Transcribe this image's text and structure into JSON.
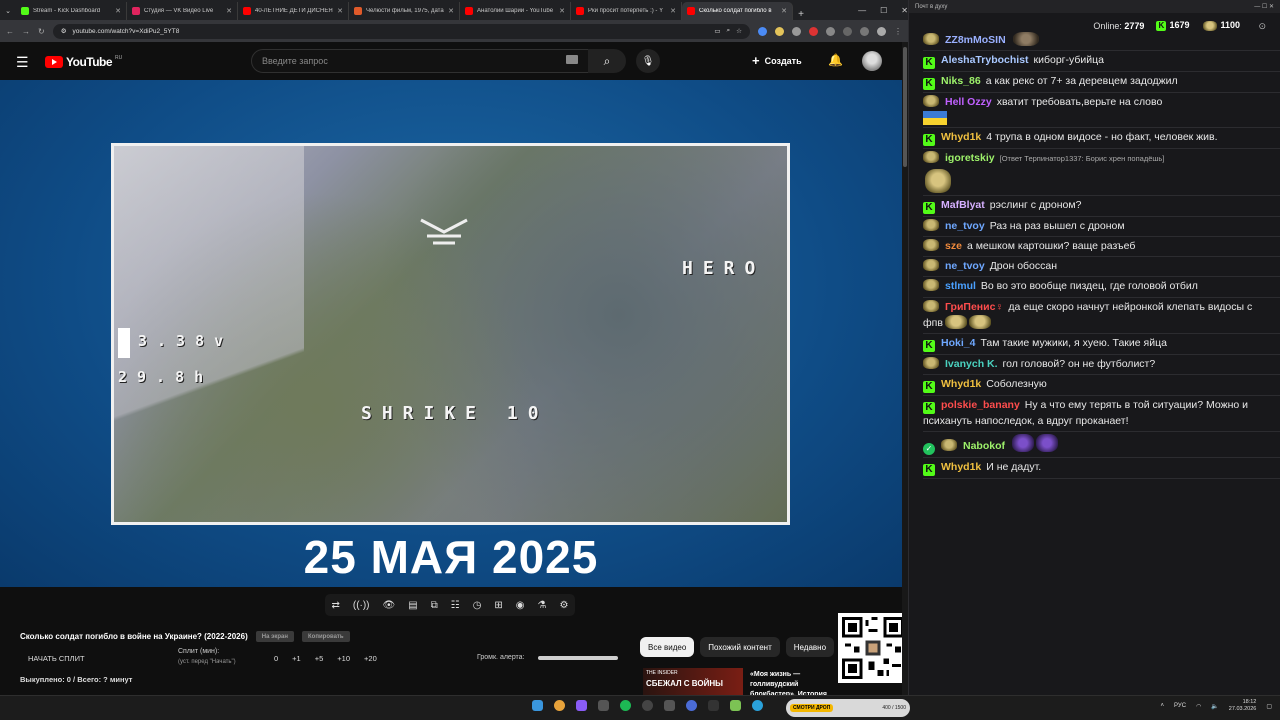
{
  "browser": {
    "tabs": [
      {
        "label": "Stream - Kick Dashboard",
        "color": "#53fc18",
        "active": false
      },
      {
        "label": "Студия — VK Видео Live",
        "color": "#e0245e",
        "active": false
      },
      {
        "label": "40-ЛЕТНИЕ ДЕТИ ДИСНЕЯ",
        "color": "#ff0000",
        "active": false
      },
      {
        "label": "Челюсти фильм, 1975, дата",
        "color": "#e05a2a",
        "active": false
      },
      {
        "label": "Анатолий Шарий - YouTube",
        "color": "#ff0000",
        "active": false
      },
      {
        "label": "Рки просит потерпеть :) - Y",
        "color": "#ff0000",
        "active": false
      },
      {
        "label": "Сколько солдат погибло в",
        "color": "#ff0000",
        "active": true
      }
    ],
    "new_tab": "+",
    "url": "youtube.com/watch?v=XdiPu2_5YT8"
  },
  "youtube": {
    "logo_text": "YouTube",
    "region": "RU",
    "search_placeholder": "Введите запрос",
    "create_label": "Создать"
  },
  "video": {
    "osd_hero": "HERO",
    "osd_volt": "3.38v",
    "osd_mah": "29.8h",
    "osd_strike": "SHRIKE 10",
    "caption": "25 МАЯ 2025"
  },
  "player_tools": [
    "⇄",
    "((·))",
    "👁",
    "▤",
    "⧉",
    "☷",
    "◷",
    "⊞",
    "◉",
    "⚗",
    "⚙"
  ],
  "below": {
    "title": "Сколько солдат погибло в войне на Украине? (2022-2026)",
    "chip_a": "На экран",
    "chip_b": "Копировать",
    "split_start": "НАЧАТЬ СПЛИТ",
    "split_label": "Сплит (мин):",
    "split_sub": "(уст. перед \"Начать\")",
    "split_nums": [
      "0",
      "+1",
      "+5",
      "+10",
      "+20"
    ],
    "alert_label": "Громк. алерта:",
    "bought": "Выкуплено: 0 / Всего: ? минут",
    "chips": [
      "Все видео",
      "Похожий контент",
      "Недавно"
    ],
    "rec_thumb_top": "THE INSIDER",
    "rec_thumb_big": "СБЕЖАЛ С ВОЙНЫ",
    "rec_title": "«Моя жизнь — голливудский блокбастер». История казак..."
  },
  "chat": {
    "window_title": "Почт в духу",
    "online_label": "Online:",
    "online_value": "2779",
    "kick_count": "1679",
    "emote_count": "1100",
    "messages": [
      {
        "badge": "e",
        "nick": "ZZ8mMoSIN",
        "color": "#9ab0ff",
        "text": "",
        "emote": "face"
      },
      {
        "badge": "k",
        "nick": "AleshaTrybochist",
        "color": "#a9c8ff",
        "text": "киборг-убийца"
      },
      {
        "badge": "k",
        "nick": "Niks_86",
        "color": "#9ef26b",
        "text": "а как рекс от 7+ за деревцем задоджил"
      },
      {
        "badge": "e",
        "nick": "Hell Ozzy",
        "color": "#c060ff",
        "text": "хватит требовать,верьте на слово",
        "flag": true
      },
      {
        "badge": "k",
        "nick": "Whyd1k",
        "color": "#f0c040",
        "text": "4 трупа в одном видосе - но факт, человек жив."
      },
      {
        "badge": "e",
        "nick": "igoretskiy",
        "color": "#9ef26b",
        "reply": "[Ответ Терпинатор1337: Борис хрен попадёшь]",
        "text": "",
        "emote": "big"
      },
      {
        "badge": "k",
        "nick": "MafBlyat",
        "color": "#d6b0ff",
        "text": "рэслинг с дроном?"
      },
      {
        "badge": "e",
        "nick": "ne_tvoy",
        "color": "#6fa8ff",
        "text": "Раз на раз вышел с дроном"
      },
      {
        "badge": "e",
        "nick": "sze",
        "color": "#f08a3c",
        "text": "а мешком картошки? ваще разъеб"
      },
      {
        "badge": "e",
        "nick": "ne_tvoy",
        "color": "#6fa8ff",
        "text": "Дрон обоссан"
      },
      {
        "badge": "e",
        "nick": "stlmul",
        "color": "#4aa0ff",
        "text": "Во во это вообще пиздец, где головой отбил"
      },
      {
        "badge": "e",
        "nick": "ГриПенис♀",
        "color": "#ff4d4d",
        "text": "да еще скоро начнут нейронкой клепать видосы с фпв",
        "emote": "two"
      },
      {
        "badge": "k",
        "nick": "Hoki_4",
        "color": "#6fa8ff",
        "text": "Там такие мужики, я хуею. Такие яйца"
      },
      {
        "badge": "e",
        "nick": "Ivanych K.",
        "color": "#4ad2c0",
        "text": "гол головой? он не футболист?"
      },
      {
        "badge": "k",
        "nick": "Whyd1k",
        "color": "#f0c040",
        "text": "Соболезную"
      },
      {
        "badge": "k",
        "nick": "polskie_banany",
        "color": "#ff4d4d",
        "text": "Ну а что ему терять в той ситуации? Можно и психануть напоследок, а вдруг проканает!"
      },
      {
        "badge": "v",
        "nick": "Nabokof",
        "color": "#9ef26b",
        "text": "",
        "emote": "purple"
      },
      {
        "badge": "k",
        "nick": "Whyd1k",
        "color": "#f0c040",
        "text": "И не дадут."
      }
    ]
  },
  "taskbar": {
    "promo_text": "СМОТРИ ДРОП",
    "promo_count": "400 / 1500",
    "lang": "РУС",
    "time": "18:12",
    "date": "27.03.2026"
  }
}
